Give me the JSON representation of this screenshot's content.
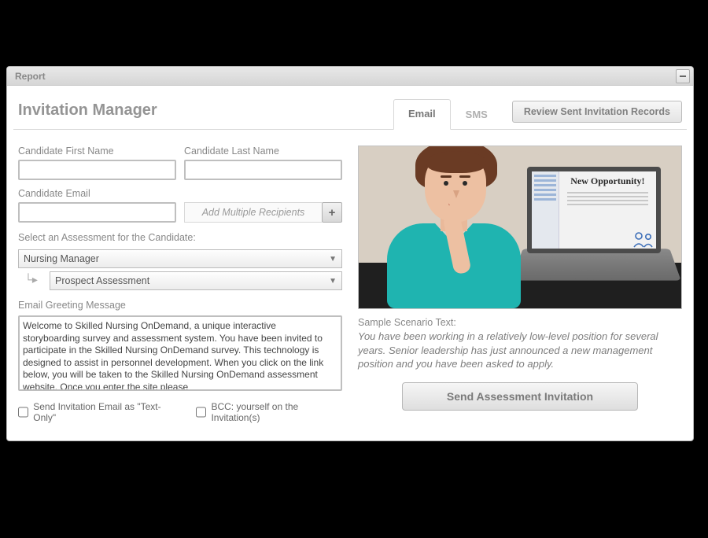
{
  "window": {
    "title": "Report"
  },
  "panel": {
    "title": "Invitation Manager"
  },
  "tabs": {
    "email": "Email",
    "sms": "SMS",
    "active": "email"
  },
  "buttons": {
    "review": "Review Sent Invitation Records",
    "add_multiple": "Add Multiple Recipients",
    "send": "Send Assessment Invitation"
  },
  "fields": {
    "first_name": {
      "label": "Candidate First Name",
      "value": ""
    },
    "last_name": {
      "label": "Candidate Last Name",
      "value": ""
    },
    "email": {
      "label": "Candidate Email",
      "value": ""
    }
  },
  "assessment": {
    "label": "Select an Assessment for the Candidate:",
    "primary": "Nursing Manager",
    "secondary": "Prospect Assessment"
  },
  "greeting": {
    "label": "Email Greeting Message",
    "value": "Welcome to Skilled Nursing OnDemand, a unique interactive storyboarding survey and assessment system. You have been invited to participate in the Skilled Nursing OnDemand survey. This technology is designed to assist in personnel development. When you click on the link below, you will be taken to the Skilled Nursing OnDemand assessment website. Once you enter the site please"
  },
  "options": {
    "text_only": "Send Invitation Email as \"Text-Only\"",
    "bcc": "BCC: yourself on the Invitation(s)"
  },
  "scenario": {
    "screen_headline": "New Opportunity!",
    "label": "Sample Scenario Text:",
    "text": "You have been working in a relatively low-level position for several years. Senior leadership has just announced a new management position and you have been asked to apply."
  }
}
